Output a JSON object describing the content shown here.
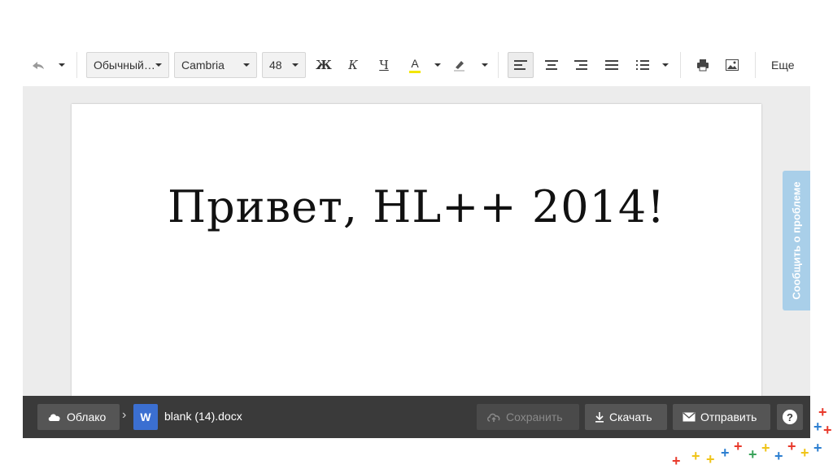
{
  "toolbar": {
    "style_select": "Обычный…",
    "font_select": "Cambria",
    "size_select": "48",
    "bold": "Ж",
    "italic": "К",
    "underline": "Ч",
    "font_color": "А",
    "more_label": "Еще"
  },
  "document": {
    "text": "Привет, HL++ 2014!"
  },
  "feedback_tab": "Сообщить о проблеме",
  "bottom_bar": {
    "cloud_label": "Облако",
    "file_name": "blank (14).docx",
    "word_icon_letter": "W",
    "save_label": "Сохранить",
    "download_label": "Скачать",
    "send_label": "Отправить",
    "help_label": "?"
  },
  "colors": {
    "accent_blue": "#3b6fd1",
    "feedback_blue": "#a9cfe9",
    "bottom_bar": "#3a3a3a"
  }
}
